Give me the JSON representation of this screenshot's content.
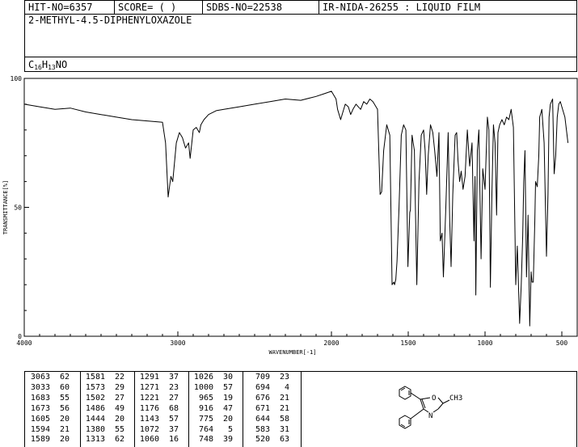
{
  "header": {
    "hit": "HIT-NO=6357",
    "score": "SCORE=  (   )",
    "sdbs": "SDBS-NO=22538",
    "ir": "IR-NIDA-26255 : LIQUID FILM"
  },
  "compound": {
    "name": "2-METHYL-4.5-DIPHENYLOXAZOLE",
    "formula_c": "C",
    "formula_c_sub": "16",
    "formula_h": "H",
    "formula_h_sub": "13",
    "formula_rest": "NO"
  },
  "structure": {
    "atom_o": "O",
    "atom_n": "N",
    "atom_ch3": "CH3"
  },
  "chart_data": {
    "type": "line",
    "xlabel": "WAVENUMBER[-1]",
    "ylabel": "TRANSMITTANCE[%]",
    "xlim": [
      4000,
      400
    ],
    "ylim": [
      0,
      100
    ],
    "x_ticks": [
      4000,
      3000,
      2000,
      1500,
      1000,
      500
    ],
    "y_ticks": [
      0,
      50,
      100
    ],
    "x_tick_labels": [
      "4000",
      "3000",
      "2000",
      "1500",
      "1000",
      "500"
    ],
    "y_tick_labels": [
      "0",
      "50",
      "100"
    ],
    "x": [
      4000,
      3900,
      3800,
      3700,
      3600,
      3500,
      3400,
      3300,
      3200,
      3100,
      3080,
      3063,
      3045,
      3033,
      3010,
      2990,
      2970,
      2950,
      2930,
      2920,
      2900,
      2880,
      2860,
      2850,
      2830,
      2800,
      2750,
      2700,
      2600,
      2500,
      2400,
      2300,
      2200,
      2100,
      2050,
      2000,
      1970,
      1960,
      1940,
      1925,
      1910,
      1890,
      1875,
      1860,
      1840,
      1810,
      1790,
      1770,
      1750,
      1730,
      1700,
      1683,
      1673,
      1660,
      1640,
      1620,
      1605,
      1594,
      1589,
      1581,
      1573,
      1560,
      1545,
      1530,
      1515,
      1502,
      1490,
      1486,
      1475,
      1460,
      1444,
      1430,
      1415,
      1400,
      1390,
      1380,
      1370,
      1355,
      1340,
      1328,
      1313,
      1300,
      1291,
      1280,
      1271,
      1255,
      1240,
      1230,
      1221,
      1210,
      1195,
      1185,
      1176,
      1165,
      1155,
      1143,
      1130,
      1115,
      1100,
      1085,
      1072,
      1065,
      1060,
      1050,
      1040,
      1026,
      1015,
      1000,
      985,
      975,
      965,
      955,
      945,
      935,
      925,
      916,
      905,
      890,
      875,
      860,
      845,
      830,
      815,
      800,
      790,
      775,
      764,
      755,
      748,
      740,
      730,
      720,
      709,
      700,
      694,
      686,
      676,
      671,
      660,
      650,
      644,
      630,
      615,
      600,
      590,
      583,
      575,
      560,
      550,
      540,
      530,
      520,
      510,
      500,
      480,
      460,
      440,
      420,
      400
    ],
    "series": [
      {
        "values": [
          90,
          89,
          88,
          88.5,
          87,
          86,
          85,
          84,
          83.5,
          83,
          75,
          54,
          62,
          60,
          75,
          79,
          77,
          73,
          75,
          69,
          80,
          81,
          79,
          82,
          84,
          86,
          87.5,
          88,
          89,
          90,
          91,
          92,
          91.5,
          93,
          94,
          95,
          92,
          88,
          84,
          87,
          90,
          89,
          86,
          88,
          90,
          88,
          91,
          90,
          92,
          91,
          88,
          55,
          56,
          72,
          82,
          78,
          20,
          21,
          20,
          22,
          29,
          50,
          78,
          82,
          80,
          27,
          48,
          49,
          78,
          72,
          20,
          60,
          78,
          80,
          72,
          55,
          70,
          82,
          79,
          72,
          62,
          79,
          37,
          40,
          23,
          50,
          79,
          45,
          27,
          55,
          78,
          79,
          68,
          60,
          64,
          57,
          62,
          80,
          66,
          75,
          37,
          62,
          16,
          72,
          80,
          30,
          65,
          57,
          85,
          80,
          19,
          55,
          82,
          75,
          47,
          79,
          82,
          84,
          82,
          85,
          84,
          88,
          81,
          20,
          35,
          5,
          20,
          39,
          60,
          72,
          23,
          47,
          4,
          25,
          21,
          21,
          45,
          60,
          58,
          70,
          85,
          88,
          75,
          31,
          55,
          85,
          90,
          92,
          63,
          70,
          85,
          90,
          91,
          89,
          85,
          75
        ]
      }
    ]
  },
  "peaks": [
    {
      "wn": "3063",
      "t": "62"
    },
    {
      "wn": "3033",
      "t": "60"
    },
    {
      "wn": "1683",
      "t": "55"
    },
    {
      "wn": "1673",
      "t": "56"
    },
    {
      "wn": "1605",
      "t": "20"
    },
    {
      "wn": "1594",
      "t": "21"
    },
    {
      "wn": "1589",
      "t": "20"
    },
    {
      "wn": "1581",
      "t": "22"
    },
    {
      "wn": "1573",
      "t": "29"
    },
    {
      "wn": "1502",
      "t": "27"
    },
    {
      "wn": "1486",
      "t": "49"
    },
    {
      "wn": "1444",
      "t": "20"
    },
    {
      "wn": "1380",
      "t": "55"
    },
    {
      "wn": "1313",
      "t": "62"
    },
    {
      "wn": "1291",
      "t": "37"
    },
    {
      "wn": "1271",
      "t": "23"
    },
    {
      "wn": "1221",
      "t": "27"
    },
    {
      "wn": "1176",
      "t": "68"
    },
    {
      "wn": "1143",
      "t": "57"
    },
    {
      "wn": "1072",
      "t": "37"
    },
    {
      "wn": "1060",
      "t": "16"
    },
    {
      "wn": "1026",
      "t": "30"
    },
    {
      "wn": "1000",
      "t": "57"
    },
    {
      "wn": "965",
      "t": "19"
    },
    {
      "wn": "916",
      "t": "47"
    },
    {
      "wn": "775",
      "t": "20"
    },
    {
      "wn": "764",
      "t": "5"
    },
    {
      "wn": "748",
      "t": "39"
    },
    {
      "wn": "709",
      "t": "23"
    },
    {
      "wn": "694",
      "t": "4"
    },
    {
      "wn": "676",
      "t": "21"
    },
    {
      "wn": "671",
      "t": "21"
    },
    {
      "wn": "644",
      "t": "58"
    },
    {
      "wn": "583",
      "t": "31"
    },
    {
      "wn": "520",
      "t": "63"
    }
  ]
}
